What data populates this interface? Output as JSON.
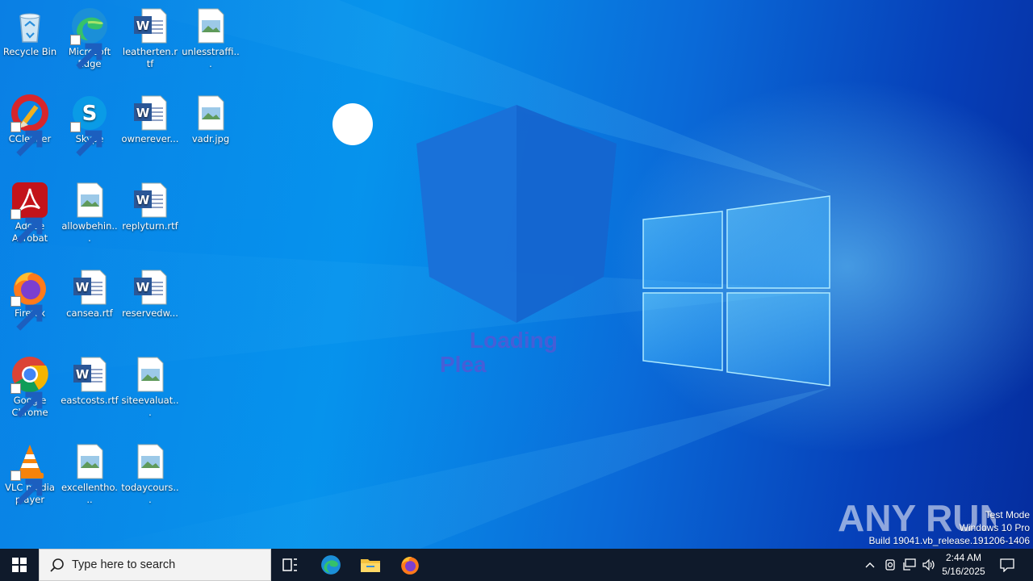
{
  "desktop": {
    "icons": [
      {
        "label": "Recycle Bin",
        "icon": "recycle-bin-icon"
      },
      {
        "label": "Microsoft Edge",
        "icon": "edge-icon"
      },
      {
        "label": "leatherten.rtf",
        "icon": "word-document-icon"
      },
      {
        "label": "unlesstraffi...",
        "icon": "image-file-icon"
      },
      {
        "label": "CCleaner",
        "icon": "ccleaner-icon"
      },
      {
        "label": "Skype",
        "icon": "skype-icon"
      },
      {
        "label": "ownerever...",
        "icon": "word-document-icon"
      },
      {
        "label": "vadr.jpg",
        "icon": "image-file-icon"
      },
      {
        "label": "Adobe Acrobat",
        "icon": "adobe-acrobat-icon"
      },
      {
        "label": "allowbehin...",
        "icon": "image-file-icon"
      },
      {
        "label": "replyturn.rtf",
        "icon": "word-document-icon"
      },
      {
        "label": "Firefox",
        "icon": "firefox-icon"
      },
      {
        "label": "cansea.rtf",
        "icon": "word-document-icon"
      },
      {
        "label": "reservedw...",
        "icon": "word-document-icon"
      },
      {
        "label": "Google Chrome",
        "icon": "chrome-icon"
      },
      {
        "label": "eastcosts.rtf",
        "icon": "word-document-icon"
      },
      {
        "label": "siteevaluat...",
        "icon": "image-file-icon"
      },
      {
        "label": "VLC media player",
        "icon": "vlc-icon"
      },
      {
        "label": "excellentho...",
        "icon": "image-file-icon"
      },
      {
        "label": "todaycours...",
        "icon": "image-file-icon"
      }
    ]
  },
  "overlay": {
    "loading": "Loading",
    "please": "Plea"
  },
  "watermark": {
    "brand": "ANY RUN",
    "line1": "Test Mode",
    "line2": "Windows 10 Pro",
    "line3": "Build 19041.vb_release.191206-1406"
  },
  "taskbar": {
    "search_placeholder": "Type here to search",
    "pinned": [
      "task-view-icon",
      "edge-icon",
      "file-explorer-icon",
      "firefox-icon"
    ],
    "clock_time": "2:44 AM",
    "clock_date": "5/16/2025"
  },
  "colors": {
    "taskbar": "#0f1a2b",
    "loading_text": "#4d5bd6",
    "cube_face_left": "#1a70d8",
    "cube_face_right": "#1565cf"
  }
}
